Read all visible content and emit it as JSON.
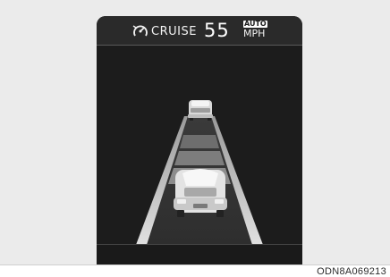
{
  "cluster": {
    "cruise_icon": "speedometer-cruise-icon",
    "cruise_label": "CRUISE",
    "set_speed": "55",
    "auto_badge": "AUTO",
    "speed_unit": "MPH"
  },
  "scene": {
    "lead_vehicle": "vehicle-ahead",
    "own_vehicle": "own-vehicle",
    "distance_bars": 3
  },
  "caption": "ODN8A069213",
  "colors": {
    "screen_background": "#1c1c1c",
    "road_edge": "#d8d8d8",
    "distance_bar": "#8a8a8a",
    "car_body": "#e3e3e3"
  }
}
